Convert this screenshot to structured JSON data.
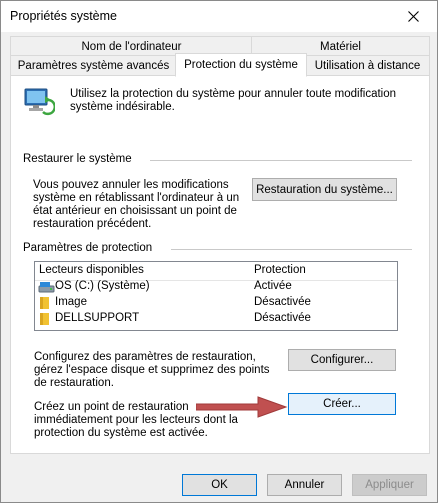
{
  "window": {
    "title": "Propriétés système"
  },
  "tabs": {
    "row1": [
      "Nom de l'ordinateur",
      "Matériel"
    ],
    "row2": [
      "Paramètres système avancés",
      "Protection du système",
      "Utilisation à distance"
    ],
    "active": "Protection du système"
  },
  "intro": {
    "text": "Utilisez la protection du système pour annuler toute modification système indésirable."
  },
  "restore": {
    "title": "Restaurer le système",
    "desc": "Vous pouvez annuler les modifications système en rétablissant l'ordinateur à un état antérieur en choisissant un point de restauration précédent.",
    "button": "Restauration du système..."
  },
  "protection": {
    "title": "Paramètres de protection",
    "columns": [
      "Lecteurs disponibles",
      "Protection"
    ],
    "drives": [
      {
        "name": "OS (C:) (Système)",
        "status": "Activée",
        "icon": "system-drive-icon"
      },
      {
        "name": "Image",
        "status": "Désactivée",
        "icon": "folder-icon"
      },
      {
        "name": "DELLSUPPORT",
        "status": "Désactivée",
        "icon": "folder-icon"
      }
    ]
  },
  "configure": {
    "desc": "Configurez des paramètres de restauration, gérez l'espace disque et supprimez des points de restauration.",
    "button": "Configurer..."
  },
  "create": {
    "desc": "Créez un point de restauration immédiatement pour les lecteurs dont la protection du système est activée.",
    "button": "Créer..."
  },
  "footer": {
    "ok": "OK",
    "cancel": "Annuler",
    "apply": "Appliquer"
  },
  "colors": {
    "accent": "#0078d7",
    "arrow": "#c05050"
  }
}
